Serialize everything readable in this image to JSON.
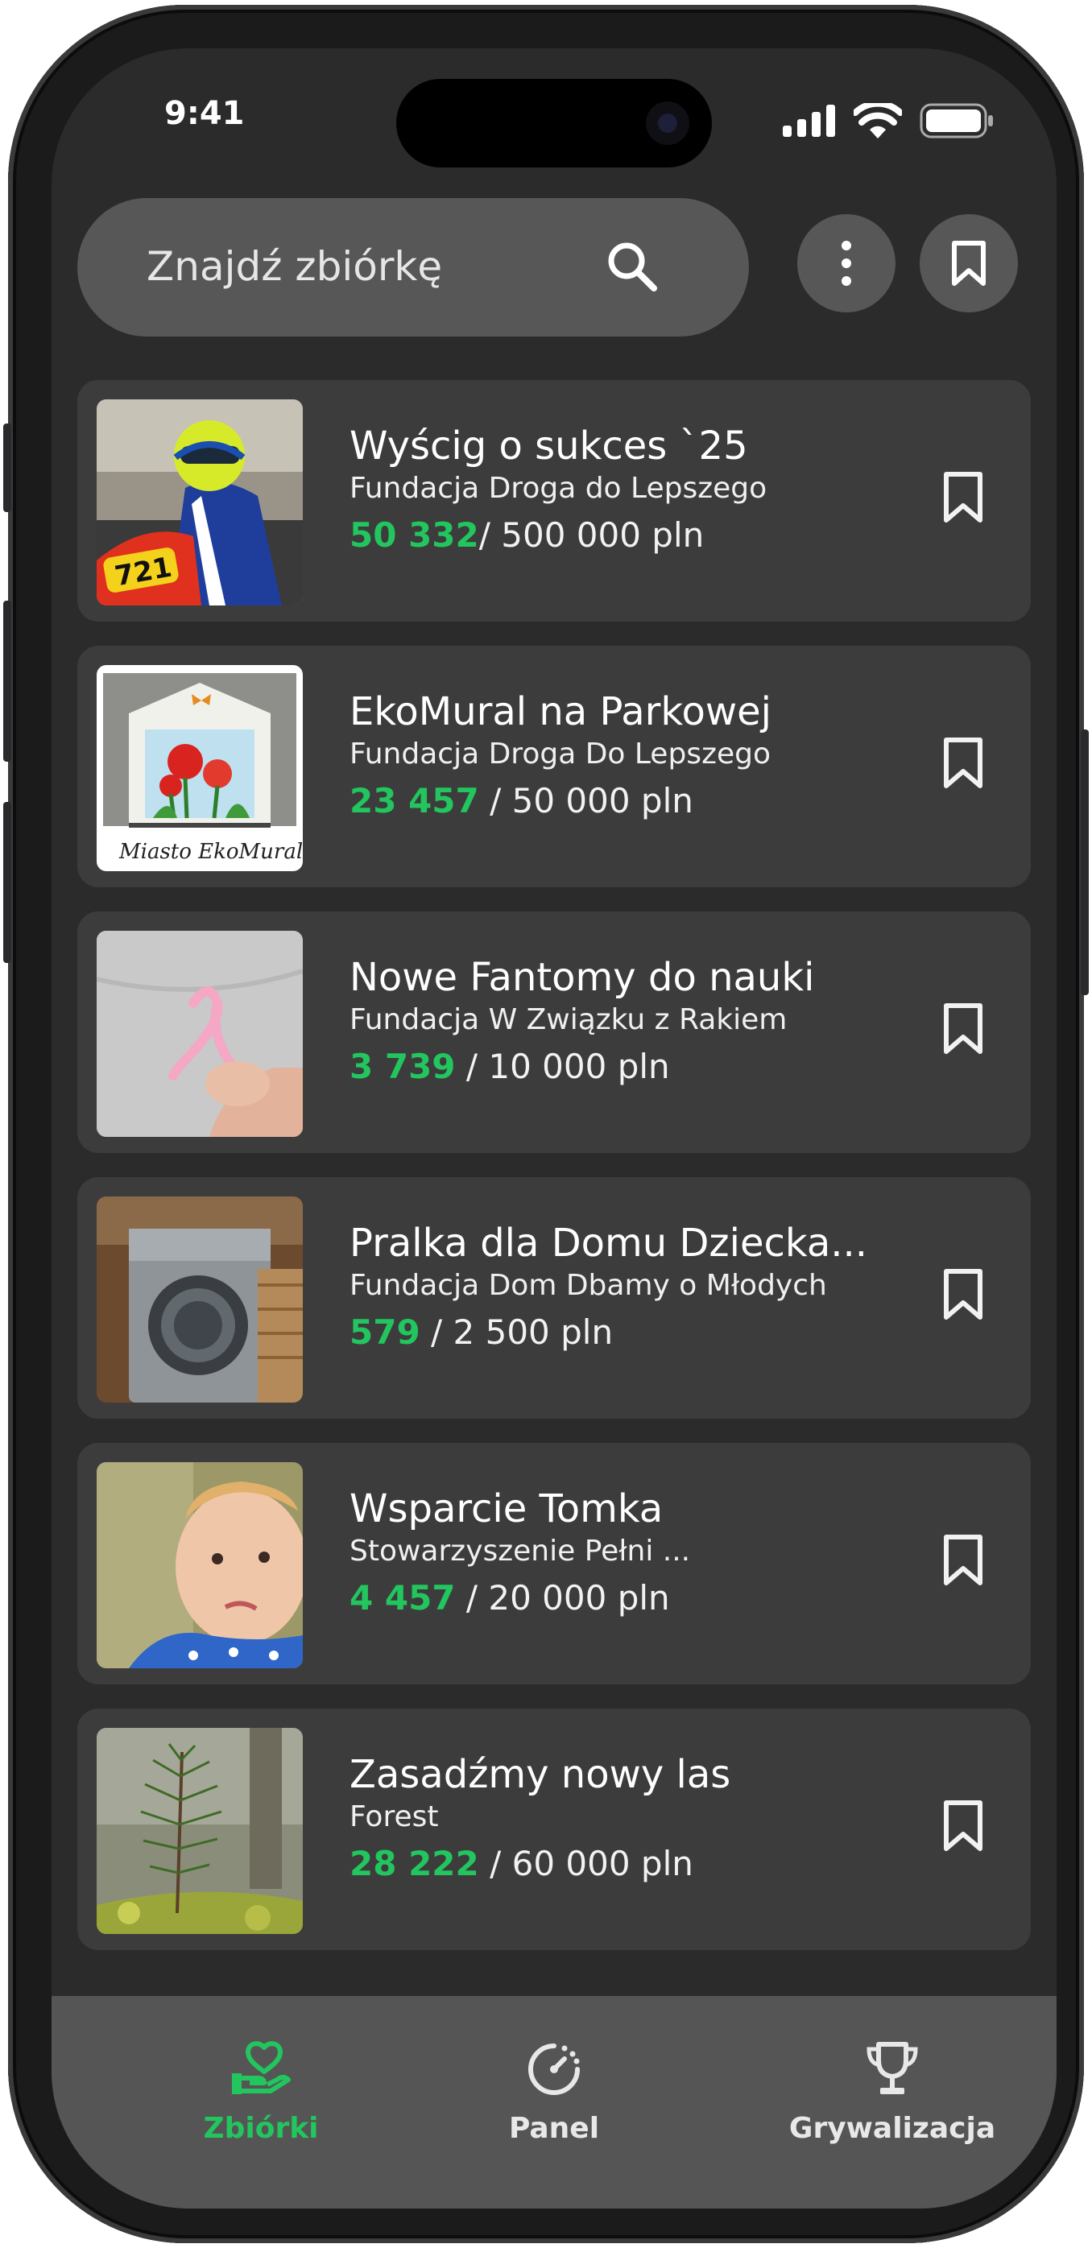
{
  "status_bar": {
    "time": "9:41"
  },
  "search": {
    "placeholder": "Znajdź zbiórkę"
  },
  "header_buttons": {
    "more_icon": "more-vertical-icon",
    "saved_icon": "bookmark-icon"
  },
  "fundraisers": [
    {
      "title": "Wyścig o sukces `25",
      "organization": "Fundacja Droga do Lepszego",
      "raised": "50 332",
      "goal": "/ 500 000 pln"
    },
    {
      "title": "EkoMural na Parkowej",
      "organization": "Fundacja Droga Do Lepszego",
      "raised": "23 457",
      "goal": " / 50 000 pln",
      "image_caption": "Miasto EkoMurali"
    },
    {
      "title": "Nowe Fantomy do nauki",
      "organization": "Fundacja W Związku z Rakiem",
      "raised": "3 739",
      "goal": " / 10 000 pln"
    },
    {
      "title": "Pralka dla Domu Dziecka...",
      "organization": "Fundacja Dom Dbamy o Młodych",
      "raised": " 579",
      "goal": " / 2 500 pln"
    },
    {
      "title": "Wsparcie Tomka",
      "organization": "Stowarzyszenie Pełni ...",
      "raised": "4 457",
      "goal": " / 20 000 pln"
    },
    {
      "title": "Zasadźmy nowy las",
      "organization": "Forest",
      "raised": "28 222",
      "goal": " / 60 000 pln"
    }
  ],
  "tabbar": {
    "tabs": [
      {
        "label": "Zbiórki",
        "icon": "hand-heart-icon",
        "active": true
      },
      {
        "label": "Panel",
        "icon": "dashboard-gauge-icon",
        "active": false
      },
      {
        "label": "Grywalizacja",
        "icon": "trophy-icon",
        "active": false
      }
    ]
  },
  "colors": {
    "accent": "#22c55e",
    "background": "#2b2b2b",
    "card": "#3c3c3c",
    "tabbar": "#555555"
  }
}
